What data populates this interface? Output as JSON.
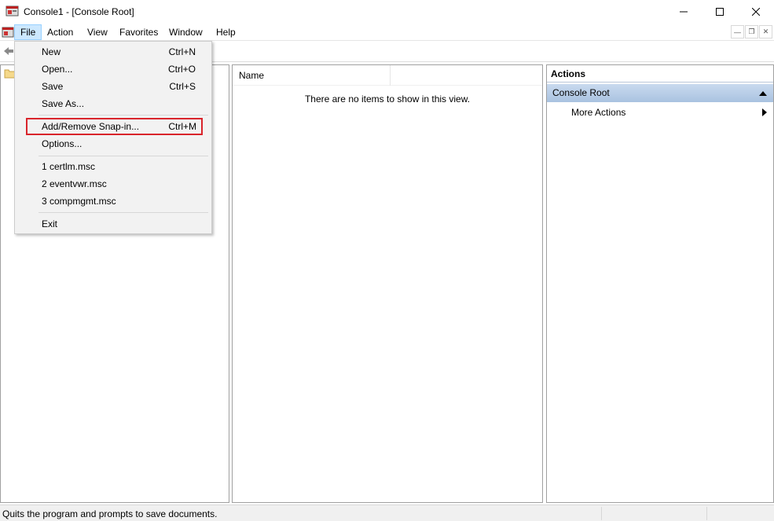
{
  "window": {
    "title": "Console1 - [Console Root]"
  },
  "menubar": {
    "items": [
      "File",
      "Action",
      "View",
      "Favorites",
      "Window",
      "Help"
    ]
  },
  "file_menu": {
    "new": {
      "label": "New",
      "shortcut": "Ctrl+N"
    },
    "open": {
      "label": "Open...",
      "shortcut": "Ctrl+O"
    },
    "save": {
      "label": "Save",
      "shortcut": "Ctrl+S"
    },
    "save_as": {
      "label": "Save As..."
    },
    "add_remove": {
      "label": "Add/Remove Snap-in...",
      "shortcut": "Ctrl+M"
    },
    "options": {
      "label": "Options..."
    },
    "recent": [
      "1 certlm.msc",
      "2 eventvwr.msc",
      "3 compmgmt.msc"
    ],
    "exit": {
      "label": "Exit"
    }
  },
  "list_pane": {
    "column_name": "Name",
    "empty_message": "There are no items to show in this view."
  },
  "actions_pane": {
    "header": "Actions",
    "section": "Console Root",
    "more_actions": "More Actions"
  },
  "statusbar": {
    "text": "Quits the program and prompts to save documents."
  },
  "colors": {
    "highlight_outline": "#d9242b",
    "section_bg": "#b6cce4",
    "menu_active_bg": "#cce8ff"
  }
}
